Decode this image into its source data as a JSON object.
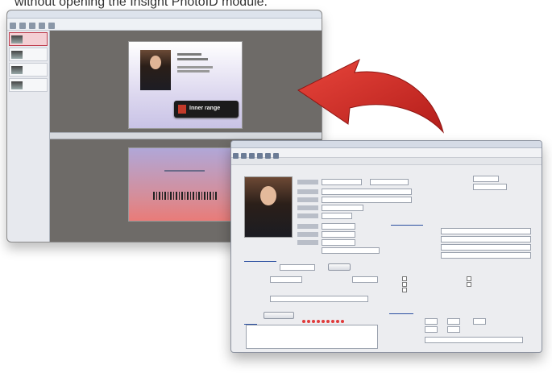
{
  "caption": "without opening the Insight PhotoID module.",
  "back_window": {
    "logo_text": "Inner range"
  },
  "colors": {
    "arrow": "#d63027",
    "selected_template": "#f4cfd4",
    "section_heading": "#2a4fa0",
    "status_dots": "#e03a3a"
  }
}
